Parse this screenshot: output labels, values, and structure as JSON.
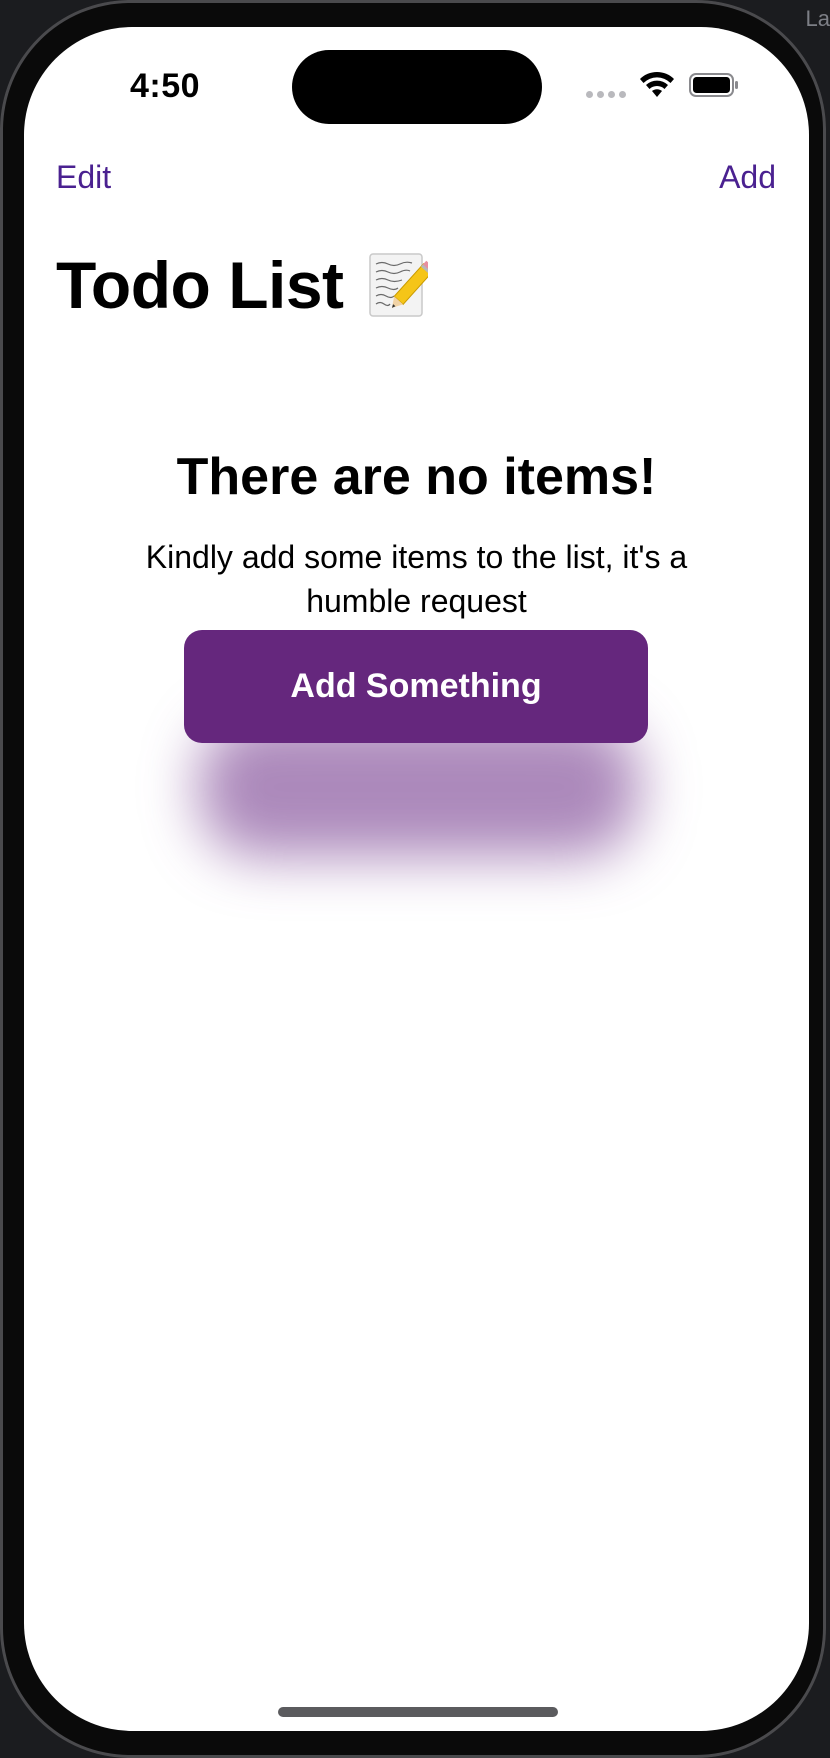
{
  "backdrop": {
    "corner_label": "La"
  },
  "status_bar": {
    "time": "4:50"
  },
  "nav": {
    "edit_label": "Edit",
    "add_label": "Add"
  },
  "header": {
    "title": "Todo List",
    "icon": "memo-icon"
  },
  "empty_state": {
    "title": "There are no items!",
    "message": "Kindly add some items to the list, it's a humble request",
    "button_label": "Add Something"
  },
  "colors": {
    "accent": "#4a2190",
    "button_bg": "#65277d",
    "button_text": "#ffffff"
  }
}
